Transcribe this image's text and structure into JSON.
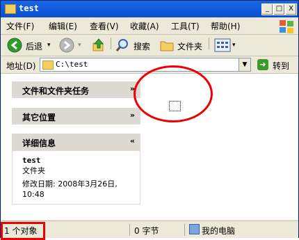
{
  "window": {
    "title": "test"
  },
  "titlebar": {
    "minimize": "_",
    "maximize": "□",
    "close": "X"
  },
  "menu": {
    "items": [
      "文件(F)",
      "编辑(E)",
      "查看(V)",
      "收藏(A)",
      "工具(T)",
      "帮助(H)"
    ]
  },
  "toolbar": {
    "back": "后退",
    "search": "搜索",
    "folders": "文件夹"
  },
  "address": {
    "label": "地址(D)",
    "value": "C:\\test",
    "go": "转到"
  },
  "taskpane": {
    "file_tasks": "文件和文件夹任务",
    "other_places": "其它位置",
    "details": {
      "header": "详细信息",
      "name": "test",
      "type": "文件夹",
      "modified": "修改日期: 2008年3月26日, 10:48"
    }
  },
  "status": {
    "objects": "1 个对象",
    "size": "0 字节",
    "location": "我的电脑"
  },
  "colors": {
    "titlebar": "#0a4fd1",
    "annotation": "#e00000"
  },
  "icons": [
    "folder-icon",
    "back-icon",
    "forward-icon",
    "up-icon",
    "search-icon",
    "folders-icon",
    "views-icon",
    "go-icon",
    "computer-icon",
    "windows-logo-icon"
  ]
}
